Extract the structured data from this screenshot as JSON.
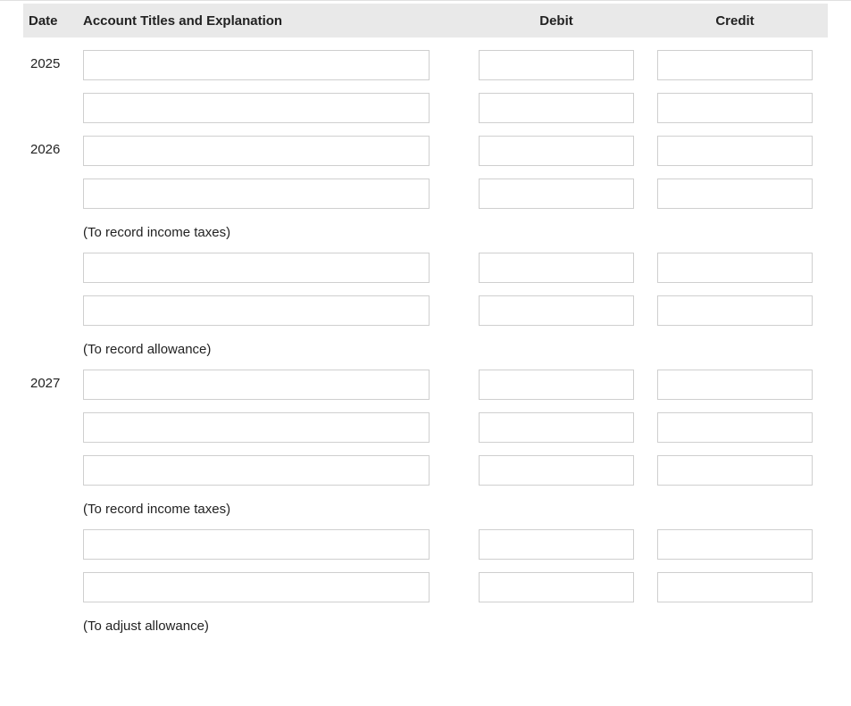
{
  "headers": {
    "date": "Date",
    "account": "Account Titles and Explanation",
    "debit": "Debit",
    "credit": "Credit"
  },
  "rows": [
    {
      "type": "entry",
      "date": "2025",
      "account": "",
      "debit": "",
      "credit": ""
    },
    {
      "type": "entry",
      "date": "",
      "account": "",
      "debit": "",
      "credit": ""
    },
    {
      "type": "entry",
      "date": "2026",
      "account": "",
      "debit": "",
      "credit": ""
    },
    {
      "type": "entry",
      "date": "",
      "account": "",
      "debit": "",
      "credit": ""
    },
    {
      "type": "explanation",
      "text": "(To record income taxes)"
    },
    {
      "type": "entry",
      "date": "",
      "account": "",
      "debit": "",
      "credit": ""
    },
    {
      "type": "entry",
      "date": "",
      "account": "",
      "debit": "",
      "credit": ""
    },
    {
      "type": "explanation",
      "text": "(To record allowance)"
    },
    {
      "type": "entry",
      "date": "2027",
      "account": "",
      "debit": "",
      "credit": ""
    },
    {
      "type": "entry",
      "date": "",
      "account": "",
      "debit": "",
      "credit": ""
    },
    {
      "type": "entry",
      "date": "",
      "account": "",
      "debit": "",
      "credit": ""
    },
    {
      "type": "explanation",
      "text": "(To record income taxes)"
    },
    {
      "type": "entry",
      "date": "",
      "account": "",
      "debit": "",
      "credit": ""
    },
    {
      "type": "entry",
      "date": "",
      "account": "",
      "debit": "",
      "credit": ""
    },
    {
      "type": "explanation",
      "text": "(To adjust allowance)"
    }
  ]
}
